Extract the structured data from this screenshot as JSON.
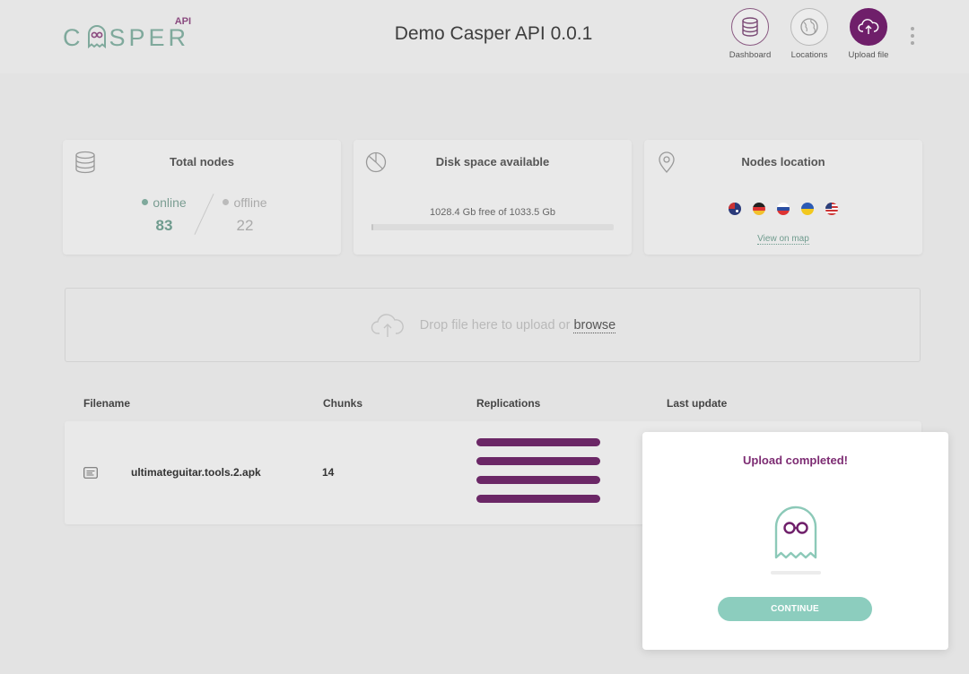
{
  "header": {
    "logo_text": "CASPER",
    "logo_badge": "API",
    "title": "Demo Casper API 0.0.1",
    "nav": [
      {
        "label": "Dashboard",
        "icon": "database-icon"
      },
      {
        "label": "Locations",
        "icon": "globe-icon"
      },
      {
        "label": "Upload file",
        "icon": "cloud-upload-icon"
      }
    ]
  },
  "cards": {
    "total_nodes": {
      "title": "Total nodes",
      "online_label": "online",
      "online_value": "83",
      "offline_label": "offline",
      "offline_value": "22"
    },
    "disk": {
      "title": "Disk space available",
      "text": "1028.4 Gb free of 1033.5 Gb",
      "used_fraction": 0.005
    },
    "location": {
      "title": "Nodes location",
      "flags": [
        "Australia",
        "Germany",
        "Russia",
        "Ukraine",
        "USA"
      ],
      "link": "View on map"
    }
  },
  "dropzone": {
    "text": "Drop file here to upload or",
    "browse": "browse"
  },
  "table": {
    "headers": {
      "filename": "Filename",
      "chunks": "Chunks",
      "replications": "Replications",
      "last_update": "Last update"
    },
    "rows": [
      {
        "filename": "ultimateguitar.tools.2.apk",
        "chunks": "14",
        "replications": 4
      }
    ]
  },
  "modal": {
    "title": "Upload completed!",
    "button": "CONTINUE"
  },
  "colors": {
    "brand_purple": "#6f1f6a",
    "brand_teal": "#7fa99c",
    "button_teal": "#8ccdbe"
  }
}
